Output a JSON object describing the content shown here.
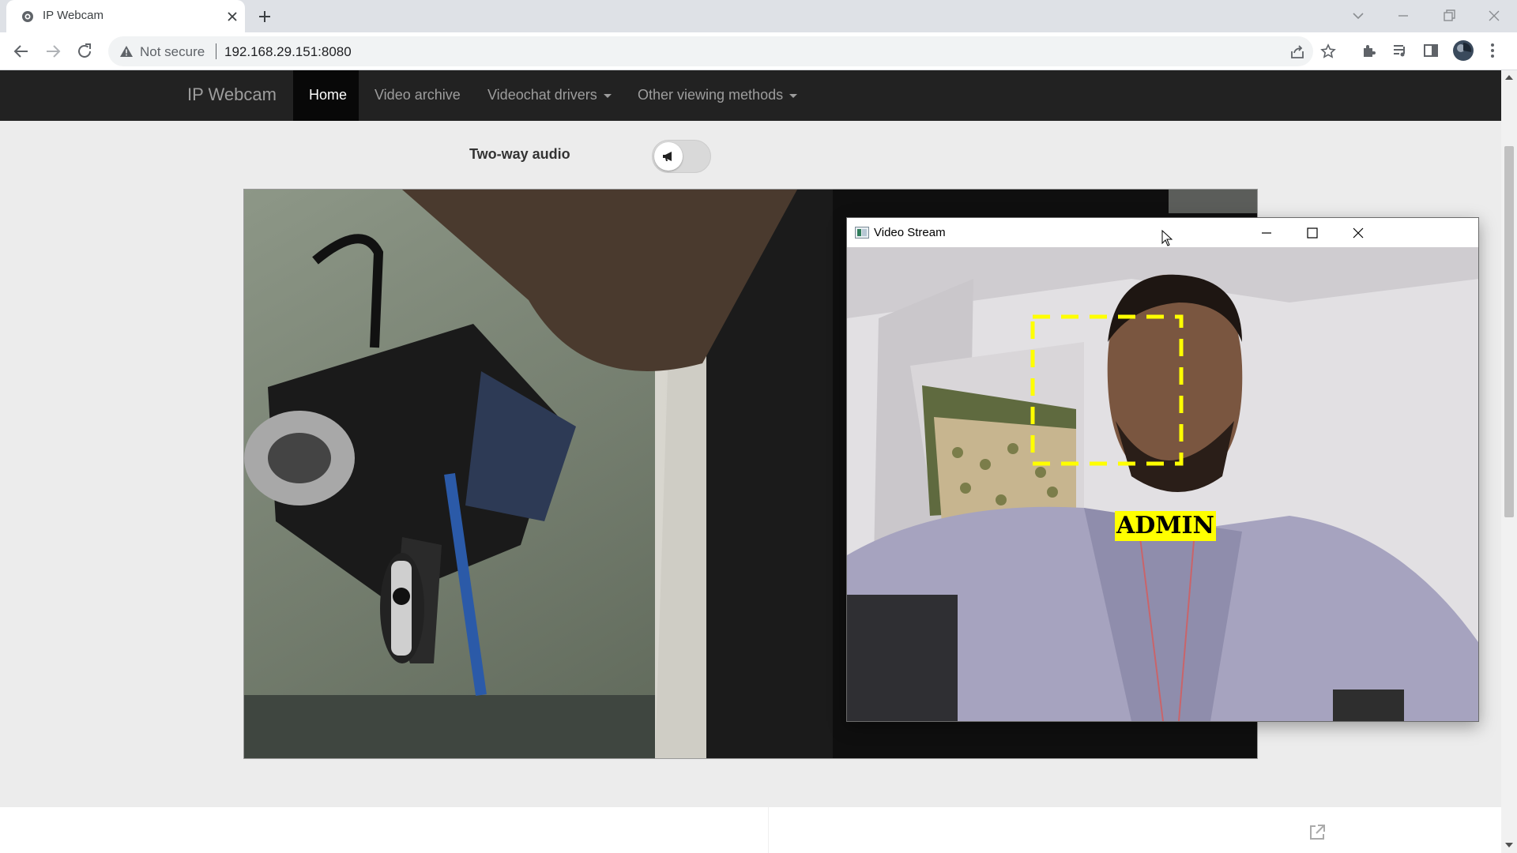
{
  "browser": {
    "tab_title": "IP Webcam",
    "security_label": "Not secure",
    "url": "192.168.29.151:8080"
  },
  "navbar": {
    "brand": "IP Webcam",
    "items": [
      {
        "label": "Home"
      },
      {
        "label": "Video archive"
      },
      {
        "label": "Videochat drivers"
      },
      {
        "label": "Other viewing methods"
      }
    ]
  },
  "audio": {
    "label": "Two-way audio"
  },
  "video_window": {
    "title": "Video Stream",
    "detection_label": "ADMIN"
  },
  "colors": {
    "navbar_bg": "#222222",
    "detection_box": "#ffff00"
  },
  "icons": [
    "tab-favicon",
    "close-icon",
    "plus-icon",
    "chevron-down-icon",
    "minimize-icon",
    "restore-icon",
    "back-arrow-icon",
    "forward-arrow-icon",
    "reload-icon",
    "warning-icon",
    "share-icon",
    "star-icon",
    "extensions-icon",
    "media-control-icon",
    "side-panel-icon",
    "profile-avatar",
    "more-vert-icon",
    "megaphone-icon",
    "maximize-icon",
    "external-link-icon"
  ]
}
